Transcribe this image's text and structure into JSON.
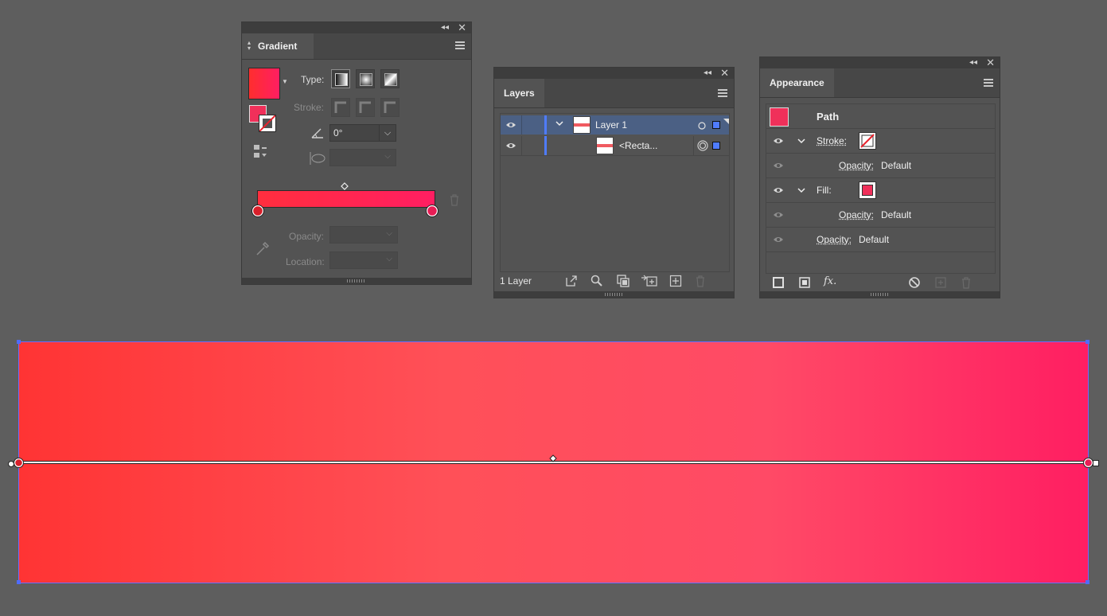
{
  "gradient_panel": {
    "tab": "Gradient",
    "type_label": "Type:",
    "stroke_label": "Stroke:",
    "angle_value": "0°",
    "opacity_label": "Opacity:",
    "location_label": "Location:",
    "fill_color": "#f0305a",
    "start_stop_color": "#ff2e2e",
    "end_stop_color": "#ff1e62"
  },
  "layers_panel": {
    "tab": "Layers",
    "rows": [
      {
        "name": "Layer 1"
      },
      {
        "name": "<Recta..."
      }
    ],
    "footer_count": "1 Layer"
  },
  "appearance_panel": {
    "tab": "Appearance",
    "object": "Path",
    "stroke_label": "Stroke:",
    "fill_label": "Fill:",
    "opacity_label": "Opacity:",
    "opacity_value": "Default",
    "fx_label": "fx.",
    "fill_swatch": "#f0305a"
  },
  "colors": {
    "panel_bg": "#535353",
    "selection": "#4b6084",
    "canvas_bg": "#5e5e5e"
  }
}
